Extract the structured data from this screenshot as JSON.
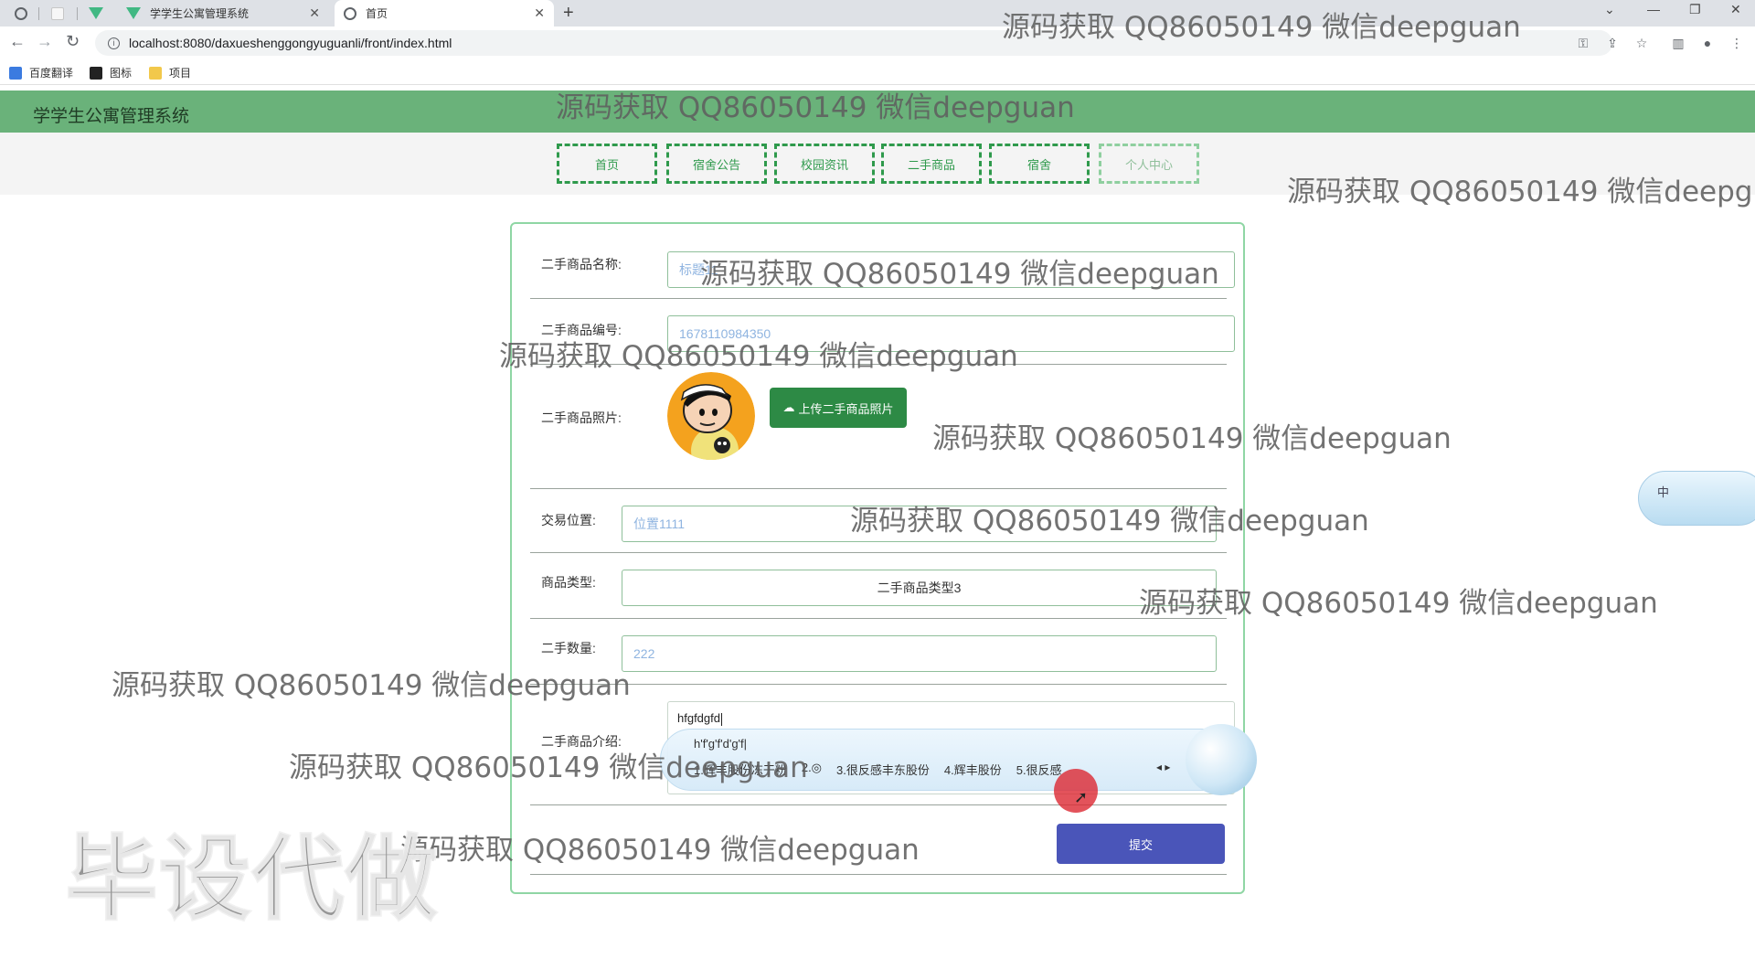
{
  "browser": {
    "tabs": [
      {
        "label": "学学生公寓管理系统"
      },
      {
        "label": "首页"
      }
    ],
    "url": "localhost:8080/daxueshenggongyuguanli/front/index.html",
    "bookmarks": [
      "百度翻译",
      "图标",
      "项目"
    ]
  },
  "site": {
    "title": "学学生公寓管理系统",
    "nav": [
      "首页",
      "宿舍公告",
      "校园资讯",
      "二手商品",
      "宿舍",
      "个人中心"
    ]
  },
  "form": {
    "name_label": "二手商品名称:",
    "name_value": "标题11",
    "code_label": "二手商品编号:",
    "code_value": "1678110984350",
    "photo_label": "二手商品照片:",
    "upload_label": "上传二手商品照片",
    "location_label": "交易位置:",
    "location_value": "位置1111",
    "type_label": "商品类型:",
    "type_value": "二手商品类型3",
    "qty_label": "二手数量:",
    "qty_value": "222",
    "intro_label": "二手商品介绍:",
    "intro_value": "hfgfdgfd",
    "submit_label": "提交"
  },
  "ime": {
    "pinyin": "h'f'g'f'd'g'f|",
    "candidates": [
      "1.辉丰股份冻干粉",
      "2.◎",
      "3.很反感丰东股份",
      "4.辉丰股份",
      "5.很反感"
    ],
    "status": "中"
  },
  "watermark": {
    "text": "源码获取 QQ86050149 微信deepguan",
    "stamp": "毕设代做"
  },
  "colors": {
    "header_green": "#6ab27a",
    "nav_border": "#2f9a4c",
    "upload_button": "#2d8a45",
    "submit_button": "#4a55b9"
  }
}
